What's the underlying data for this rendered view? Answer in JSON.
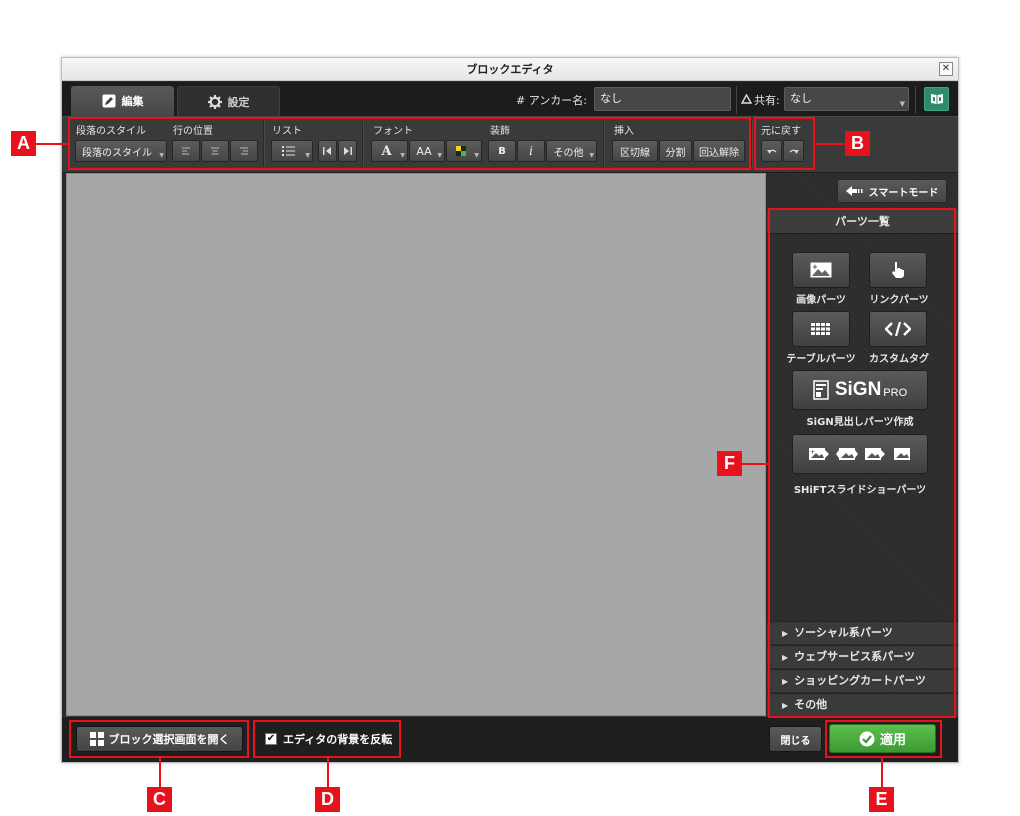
{
  "window": {
    "title": "ブロックエディタ",
    "close_label": "✕"
  },
  "tabs": [
    {
      "label": "編集",
      "icon": "pencil-icon",
      "active": true
    },
    {
      "label": "設定",
      "icon": "gear-icon",
      "active": false
    }
  ],
  "anchor": {
    "label": "# アンカー名:",
    "value": "なし"
  },
  "share": {
    "label": "共有:",
    "value": "なし",
    "icon": "share-triangle-icon"
  },
  "toolbar": {
    "paragraph_style": {
      "label": "段落のスタイル",
      "button": "段落のスタイル"
    },
    "line_position": {
      "label": "行の位置"
    },
    "list": {
      "label": "リスト"
    },
    "font": {
      "label": "フォント",
      "size_glyph": "AA",
      "color_glyph": "A"
    },
    "decoration": {
      "label": "装飾",
      "bold": "B",
      "italic": "i",
      "other": "その他"
    },
    "insert": {
      "label": "挿入",
      "hr": "区切線",
      "split": "分割",
      "unwrap": "回込解除"
    },
    "undo": {
      "label": "元に戻す"
    }
  },
  "sidebar": {
    "smart_mode": "スマートモード",
    "parts_header": "パーツ一覧",
    "parts": {
      "image": "画像パーツ",
      "link": "リンクパーツ",
      "table": "テーブルパーツ",
      "custom": "カスタムタグ",
      "sign_logo": "SiGN",
      "sign_pro": "PRO",
      "sign": "SiGN見出しパーツ作成",
      "shift": "SHiFTスライドショーパーツ"
    },
    "accordion": [
      "ソーシャル系パーツ",
      "ウェブサービス系パーツ",
      "ショッピングカートパーツ",
      "その他"
    ]
  },
  "bottom": {
    "open_block_select": "ブロック選択画面を開く",
    "invert_bg": "エディタの背景を反転",
    "close": "閉じる",
    "apply": "適用"
  },
  "callouts": [
    "A",
    "B",
    "C",
    "D",
    "E",
    "F"
  ],
  "colors": {
    "callout": "#e8121f",
    "apply": "#4aad3e",
    "book": "#2e8a6c"
  }
}
